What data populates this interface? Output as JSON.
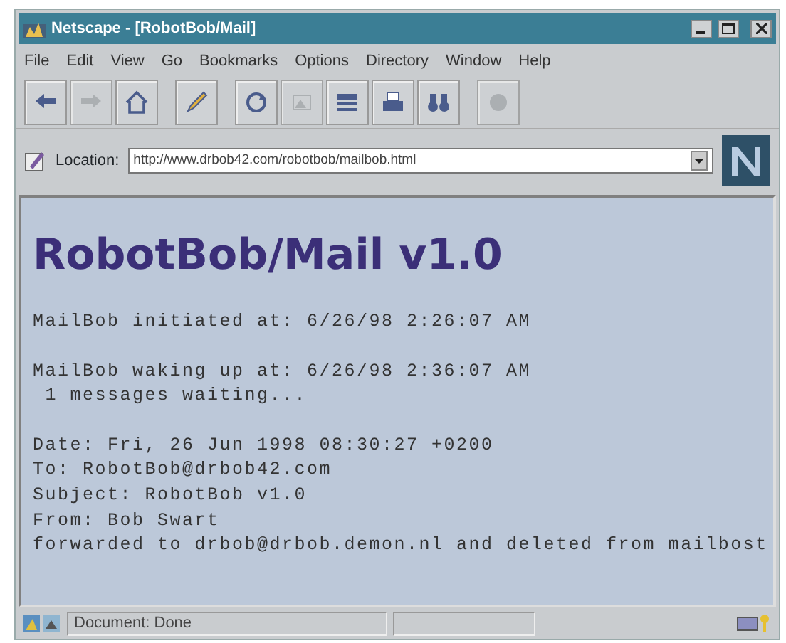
{
  "window": {
    "title": "Netscape - [RobotBob/Mail]"
  },
  "menu": [
    "File",
    "Edit",
    "View",
    "Go",
    "Bookmarks",
    "Options",
    "Directory",
    "Window",
    "Help"
  ],
  "toolbar": [
    [
      {
        "kind": "back",
        "disabled": false
      },
      {
        "kind": "forward",
        "disabled": true
      },
      {
        "kind": "home",
        "disabled": false
      }
    ],
    [
      {
        "kind": "edit",
        "disabled": false
      }
    ],
    [
      {
        "kind": "reload",
        "disabled": false
      },
      {
        "kind": "images",
        "disabled": true
      },
      {
        "kind": "open",
        "disabled": false
      },
      {
        "kind": "print",
        "disabled": false
      },
      {
        "kind": "find",
        "disabled": false
      }
    ],
    [
      {
        "kind": "stop",
        "disabled": true
      }
    ]
  ],
  "location": {
    "label": "Location:",
    "value": "http://www.drbob42.com/robotbob/mailbob.html"
  },
  "page": {
    "heading": "RobotBob/Mail v1.0",
    "blocks": [
      [
        "MailBob initiated at: 6/26/98 2:26:07 AM"
      ],
      [
        "MailBob waking up at: 6/26/98 2:36:07 AM",
        " 1 messages waiting..."
      ],
      [
        "Date: Fri, 26 Jun 1998 08:30:27 +0200",
        "To: RobotBob@drbob42.com",
        "Subject: RobotBob v1.0",
        "From: Bob Swart",
        "forwarded to drbob@drbob.demon.nl and deleted from mailbost"
      ]
    ]
  },
  "status_bar": {
    "text": "Document: Done"
  }
}
